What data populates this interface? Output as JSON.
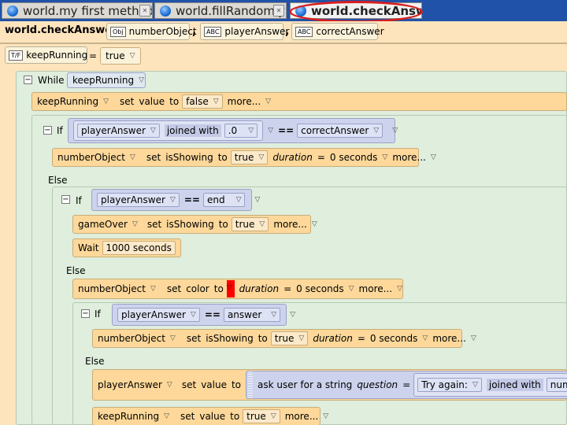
{
  "tabs": [
    {
      "label": "world.my first method"
    },
    {
      "label": "world.fillRandomly"
    },
    {
      "label": "world.checkAnswer"
    }
  ],
  "method": {
    "title": "world.checkAnswer",
    "params": [
      {
        "icon": "Obj",
        "name": "numberObject"
      },
      {
        "icon": "ABC",
        "name": "playerAnswer"
      },
      {
        "icon": "ABC",
        "name": "correctAnswer"
      }
    ],
    "comma": ",",
    "local_var": {
      "icon": "T/F",
      "name": "keepRunning",
      "eq": "=",
      "value": "true"
    }
  },
  "code": {
    "while_kw": "While",
    "while_cond": "keepRunning",
    "set1": {
      "obj": "keepRunning",
      "verb": "set",
      "prop": "value",
      "to": "to",
      "val": "false",
      "more": "more..."
    },
    "if1": {
      "kw": "If",
      "left": "playerAnswer",
      "joined": "joined with",
      "joined_val": ".0",
      "op": "==",
      "right": "correctAnswer"
    },
    "show1": {
      "obj": "numberObject",
      "verb": "set",
      "prop": "isShowing",
      "to": "to",
      "val": "true",
      "dur_label": "duration",
      "dur_eq": "=",
      "dur_val": "0 seconds",
      "more": "more..."
    },
    "else1": "Else",
    "if2": {
      "kw": "If",
      "left": "playerAnswer",
      "op": "==",
      "right": "end"
    },
    "show2": {
      "obj": "gameOver",
      "verb": "set",
      "prop": "isShowing",
      "to": "to",
      "val": "true",
      "more": "more..."
    },
    "wait": {
      "kw": "Wait",
      "val": "1000 seconds"
    },
    "else2": "Else",
    "color": {
      "obj": "numberObject",
      "verb": "set",
      "prop": "color",
      "to": "to",
      "swatch": "#ff0000",
      "dur_label": "duration",
      "dur_eq": "=",
      "dur_val": "0 seconds",
      "more": "more..."
    },
    "if3": {
      "kw": "If",
      "left": "playerAnswer",
      "op": "==",
      "right": "answer"
    },
    "show3": {
      "obj": "numberObject",
      "verb": "set",
      "prop": "isShowing",
      "to": "to",
      "val": "true",
      "dur_label": "duration",
      "dur_eq": "=",
      "dur_val": "0 seconds",
      "more": "more..."
    },
    "else3": "Else",
    "ask": {
      "obj": "playerAnswer",
      "verb": "set",
      "prop": "value",
      "to": "to",
      "fn": "ask user for a string",
      "q_label": "question",
      "q_eq": "=",
      "q_val": "Try again:",
      "joined": "joined with",
      "tail": "numbe"
    },
    "set2": {
      "obj": "keepRunning",
      "verb": "set",
      "prop": "value",
      "to": "to",
      "val": "true",
      "more": "more..."
    }
  },
  "colors": {
    "tabbar": "#1f52a8",
    "editor_bg": "#fde4bd",
    "highlight_ellipse": "#d81e1e",
    "color_swatch": "#ff0000"
  }
}
